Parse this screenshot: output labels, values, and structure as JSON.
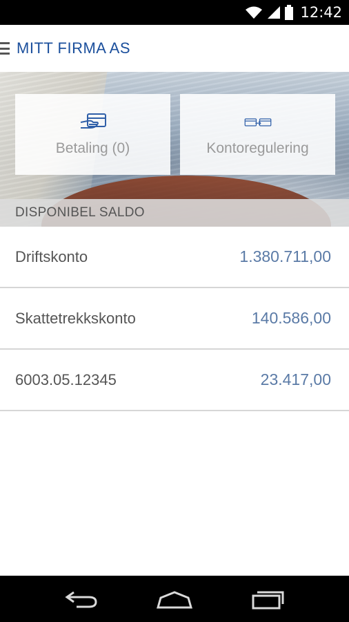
{
  "status_bar": {
    "time": "12:42",
    "icons": [
      "wifi-icon",
      "signal-icon",
      "battery-icon"
    ]
  },
  "app_bar": {
    "title": "MITT FIRMA AS",
    "menu_icon": "menu-icon"
  },
  "actions": [
    {
      "label": "Betaling (0)",
      "icon": "payment-hand-card-icon"
    },
    {
      "label": "Kontoregulering",
      "icon": "transfer-cards-icon"
    }
  ],
  "section": {
    "title": "DISPONIBEL SALDO"
  },
  "accounts": [
    {
      "name": "Driftskonto",
      "amount": "1.380.711,00"
    },
    {
      "name": "Skattetrekkskonto",
      "amount": "140.586,00"
    },
    {
      "name": "6003.05.12345",
      "amount": "23.417,00"
    }
  ],
  "nav": [
    "back-icon",
    "home-icon",
    "recent-apps-icon"
  ],
  "colors": {
    "brand": "#1b4f9c",
    "amount": "#5a7aa6",
    "icon": "#2f5fa8"
  }
}
